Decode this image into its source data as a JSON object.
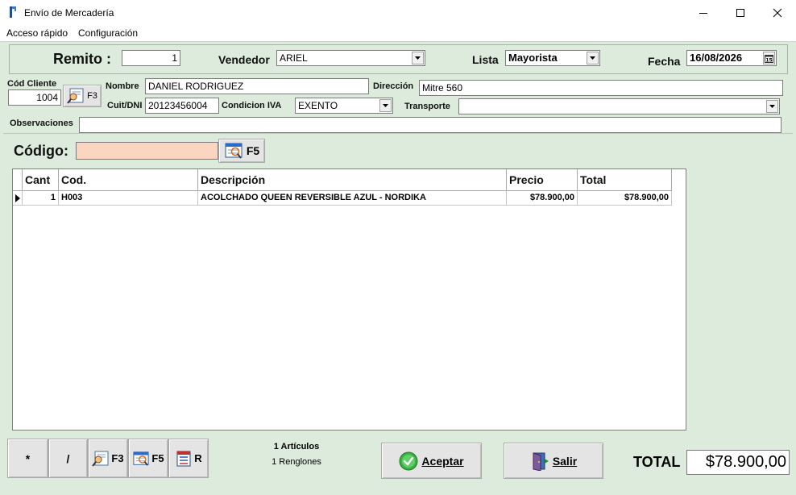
{
  "window": {
    "title": "Envío de Mercadería"
  },
  "menu": {
    "items": [
      "Acceso rápido",
      "Configuración"
    ]
  },
  "header": {
    "remito_label": "Remito :",
    "remito_value": "1",
    "vendedor_label": "Vendedor",
    "vendedor_value": "ARIEL",
    "lista_label": "Lista",
    "lista_value": "Mayorista",
    "fecha_label": "Fecha",
    "fecha_value": "16/08/2026"
  },
  "client": {
    "cod_label": "Cód Cliente",
    "cod_value": "1004",
    "search_key": "F3",
    "nombre_label": "Nombre",
    "nombre_value": "DANIEL RODRIGUEZ",
    "direccion_label": "Dirección",
    "direccion_value": "Mitre 560",
    "cuit_label": "Cuit/DNI",
    "cuit_value": "20123456004",
    "iva_label": "Condicion IVA",
    "iva_value": "EXENTO",
    "transporte_label": "Transporte",
    "transporte_value": "",
    "obs_label": "Observaciones",
    "obs_value": ""
  },
  "code_entry": {
    "label": "Código:",
    "value": "",
    "search_key": "F5",
    "input_bg": "#fad6c0"
  },
  "grid": {
    "columns": [
      "Cant",
      "Cod.",
      "Descripción",
      "Precio",
      "Total"
    ],
    "rows": [
      {
        "cant": "1",
        "cod": "H003",
        "descripcion": "ACOLCHADO QUEEN REVERSIBLE AZUL - NORDIKA",
        "precio": "$78.900,00",
        "total": "$78.900,00"
      }
    ]
  },
  "footer": {
    "btn_multiply": "*",
    "btn_divide": "/",
    "btn_f3": "F3",
    "btn_f5": "F5",
    "btn_r": "R",
    "articulos": "1 Artículos",
    "renglones": "1 Renglones",
    "accept_label": "Aceptar",
    "exit_label": "Salir",
    "total_label": "TOTAL",
    "total_value": "$78.900,00"
  },
  "colors": {
    "background": "#dcebdc",
    "accept_icon": "#3cb043"
  },
  "icons": [
    "app-icon",
    "minimize-icon",
    "maximize-icon",
    "close-icon",
    "chevron-down-icon",
    "calendar-icon",
    "client-search-icon",
    "product-search-icon",
    "report-icon",
    "check-icon",
    "door-exit-icon",
    "row-pointer-icon"
  ]
}
